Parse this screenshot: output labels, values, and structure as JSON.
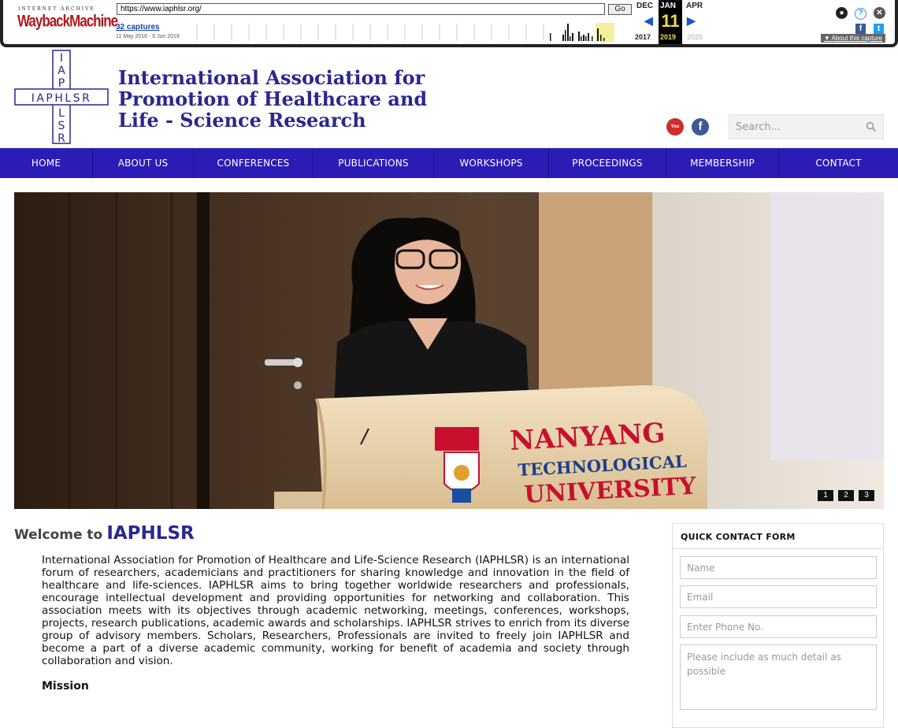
{
  "wayback": {
    "logo_top": "INTERNET ARCHIVE",
    "logo_main": "WaybackMachine",
    "url": "https://www.iaphlsr.org/",
    "go_label": "Go",
    "captures_label": "32 captures",
    "date_range": "11 May 2016 - 9 Jun 2019",
    "months": {
      "prev": "DEC",
      "current": "JAN",
      "next": "APR"
    },
    "day": "11",
    "years": {
      "prev": "2017",
      "current": "2019",
      "next": "2020"
    },
    "about_label": "About this capture"
  },
  "site": {
    "logo_vertical": "IAPHLSR",
    "logo_horizontal": "IAPHLSR",
    "title_line1": "International Association for",
    "title_line2": "Promotion of Healthcare and",
    "title_line3": "Life - Science Research",
    "youtube_label": "You Tube",
    "facebook_label": "f",
    "search_placeholder": "Search..."
  },
  "nav": [
    {
      "label": "HOME",
      "width": 118
    },
    {
      "label": "ABOUT US",
      "width": 128
    },
    {
      "label": "CONFERENCES",
      "width": 152
    },
    {
      "label": "PUBLICATIONS",
      "width": 153
    },
    {
      "label": "WORKSHOPS",
      "width": 146
    },
    {
      "label": "PROCEEDINGS",
      "width": 149
    },
    {
      "label": "MEMBERSHIP",
      "width": 143
    },
    {
      "label": "CONTACT",
      "width": 151
    }
  ],
  "hero": {
    "podium_line1": "NANYANG",
    "podium_line2": "TECHNOLOGICAL",
    "podium_line3": "UNIVERSITY",
    "slides": [
      "1",
      "2",
      "3"
    ]
  },
  "welcome": {
    "prefix": "Welcome to",
    "brand": "IAPHLSR",
    "intro": "International Association for Promotion of Healthcare and Life-Science Research (IAPHLSR) is an international forum of researchers, academicians and practitioners for sharing knowledge and innovation in the field of healthcare and life-sciences. IAPHLSR aims to bring together worldwide researchers and professionals, encourage intellectual development and providing opportunities for networking and collaboration. This association meets with its objectives through academic networking, meetings, conferences, workshops, projects, research publications, academic awards and scholarships. IAPHLSR strives to enrich from its diverse group of advisory members. Scholars, Researchers, Professionals are invited to freely join IAPHLSR and become a part of a diverse academic community, working for benefit of academia and society through collaboration and vision.",
    "mission_heading": "Mission"
  },
  "quick_contact": {
    "title": "QUICK CONTACT FORM",
    "name_placeholder": "Name",
    "email_placeholder": "Email",
    "phone_placeholder": "Enter Phone No.",
    "message_placeholder": "Please include as much detail as possible"
  },
  "colors": {
    "brand": "#2b2790",
    "nav_bg": "#2b1cb5",
    "wayback_red": "#b0191e"
  }
}
